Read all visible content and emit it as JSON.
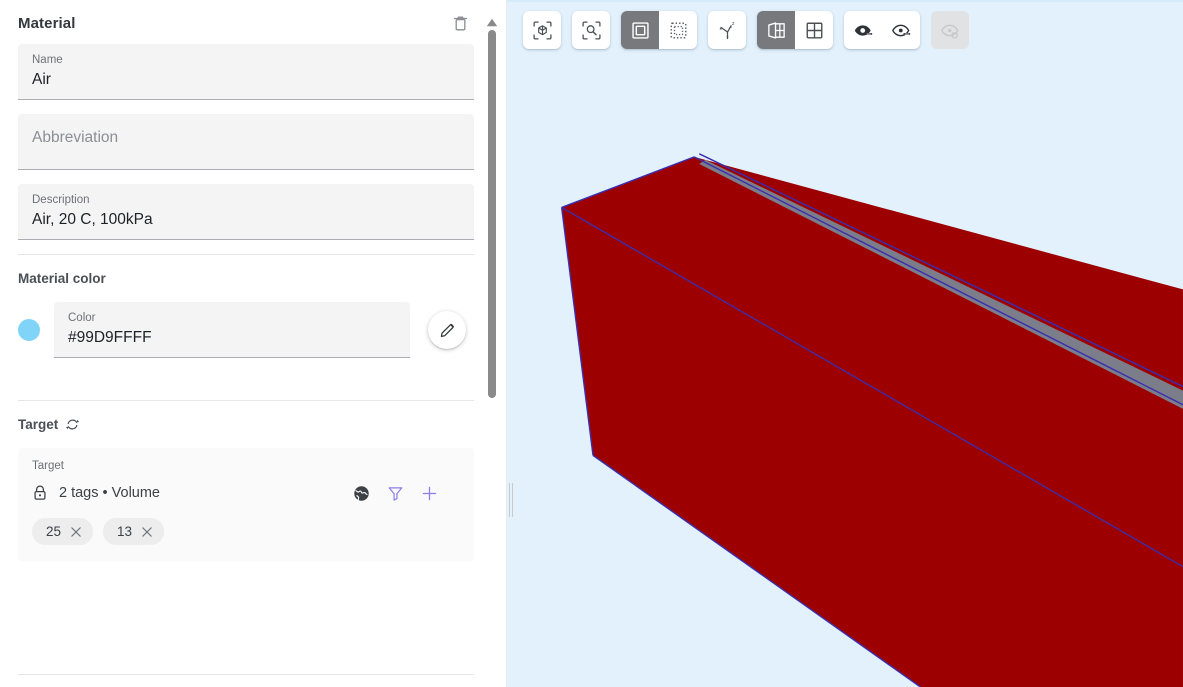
{
  "panel": {
    "title": "Material",
    "delete_icon": "trash-icon",
    "fields": [
      {
        "label": "Name",
        "value": "Air",
        "placeholder": "Name"
      },
      {
        "label": "Abbreviation",
        "value": "",
        "placeholder": "Abbreviation"
      },
      {
        "label": "Description",
        "value": "Air, 20 C, 100kPa",
        "placeholder": "Description"
      }
    ],
    "material_color": {
      "section_title": "Material color",
      "swatch_color": "#7FD4F7",
      "field_label": "Color",
      "field_value": "#99D9FFFF",
      "edit_icon": "pencil-icon"
    },
    "target": {
      "section_title": "Target",
      "refresh_icon": "refresh-icon",
      "card_label": "Target",
      "lock_icon": "lock-icon",
      "summary": "2 tags • Volume",
      "actions": [
        {
          "name": "globe-icon",
          "color": "#3c4146"
        },
        {
          "name": "filter-icon",
          "color": "#8b7fe8"
        },
        {
          "name": "plus-icon",
          "color": "#8b7fe8"
        }
      ],
      "tags": [
        {
          "label": "25"
        },
        {
          "label": "13"
        }
      ]
    },
    "scrollbar": {
      "name": "panel-scrollbar"
    }
  },
  "viewport": {
    "background_color": "#e2f1fc",
    "toolbar": [
      {
        "group": "view-fit",
        "buttons": [
          {
            "name": "fit-to-object-icon",
            "label": "Zoom to fit object",
            "active": false,
            "disabled": false
          }
        ]
      },
      {
        "group": "zoom-selection",
        "buttons": [
          {
            "name": "zoom-to-selection-icon",
            "label": "Zoom to selection",
            "active": false,
            "disabled": false
          }
        ]
      },
      {
        "group": "selection-mode",
        "buttons": [
          {
            "name": "select-single-icon",
            "label": "Single select",
            "active": true,
            "disabled": false
          },
          {
            "name": "select-box-icon",
            "label": "Box select",
            "active": false,
            "disabled": false
          }
        ]
      },
      {
        "group": "axes",
        "buttons": [
          {
            "name": "axes-triad-icon",
            "label": "Show axes",
            "active": false,
            "disabled": false
          }
        ]
      },
      {
        "group": "layout",
        "buttons": [
          {
            "name": "split-view-icon",
            "label": "Split view",
            "active": true,
            "disabled": false
          },
          {
            "name": "grid-view-icon",
            "label": "Grid view",
            "active": false,
            "disabled": false
          }
        ]
      },
      {
        "group": "visibility",
        "buttons": [
          {
            "name": "show-hidden-icon",
            "label": "Show hidden",
            "active": false,
            "disabled": false
          },
          {
            "name": "hide-selected-icon",
            "label": "Hide selected",
            "active": false,
            "disabled": false
          }
        ]
      },
      {
        "group": "visibility-reset",
        "buttons": [
          {
            "name": "reset-visibility-icon",
            "label": "Reset visibility",
            "active": false,
            "disabled": true
          }
        ]
      }
    ],
    "scene": {
      "name": "3d-solid-model",
      "body_color": "#9d0000",
      "edge_color": "#3a2fb0",
      "seam_color": "#7b7d8a"
    }
  }
}
